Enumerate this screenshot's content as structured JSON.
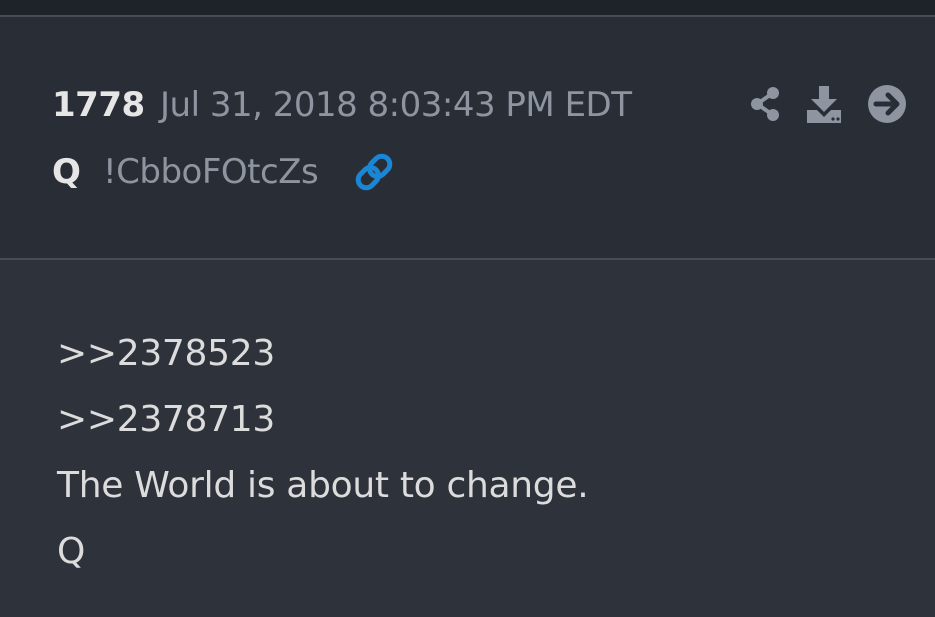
{
  "post": {
    "number": "1778",
    "timestamp": "Jul 31, 2018 8:03:43 PM EDT",
    "author": "Q",
    "tripcode": "!CbboFOtcZs",
    "body_lines": [
      ">>2378523",
      ">>2378713",
      "The World is about to change.",
      "Q"
    ]
  },
  "icons": {
    "link": "link-icon",
    "share": "share-icon",
    "download": "download-icon",
    "goto": "arrow-right-circle-icon"
  },
  "colors": {
    "background": "#2d323b",
    "header_background": "#292e36",
    "primary_text": "#e6e6e6",
    "muted_text": "#8e94a0",
    "link_accent": "#1a86d6"
  }
}
